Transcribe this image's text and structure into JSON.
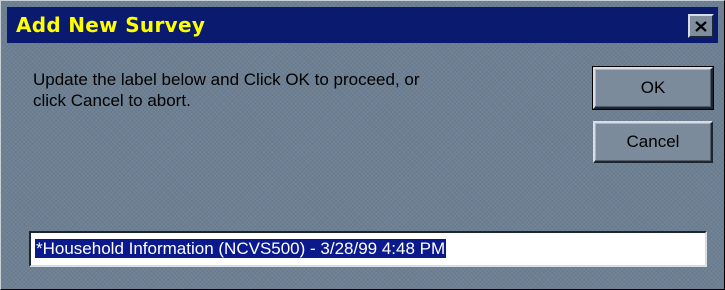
{
  "window": {
    "title": "Add New Survey",
    "close_glyph": "✕",
    "title_bg": "#0a1a6e",
    "title_color": "#ffff00"
  },
  "message": {
    "line1": "Update the label below and Click OK to proceed, or",
    "line2": "click Cancel to abort."
  },
  "buttons": {
    "ok_label": "OK",
    "cancel_label": "Cancel"
  },
  "label_field": {
    "value": "*Household Information (NCVS500) - 3/28/99 4:48 PM",
    "selection_color": "#0a1a8c"
  },
  "icons": {
    "close": "close-icon"
  }
}
